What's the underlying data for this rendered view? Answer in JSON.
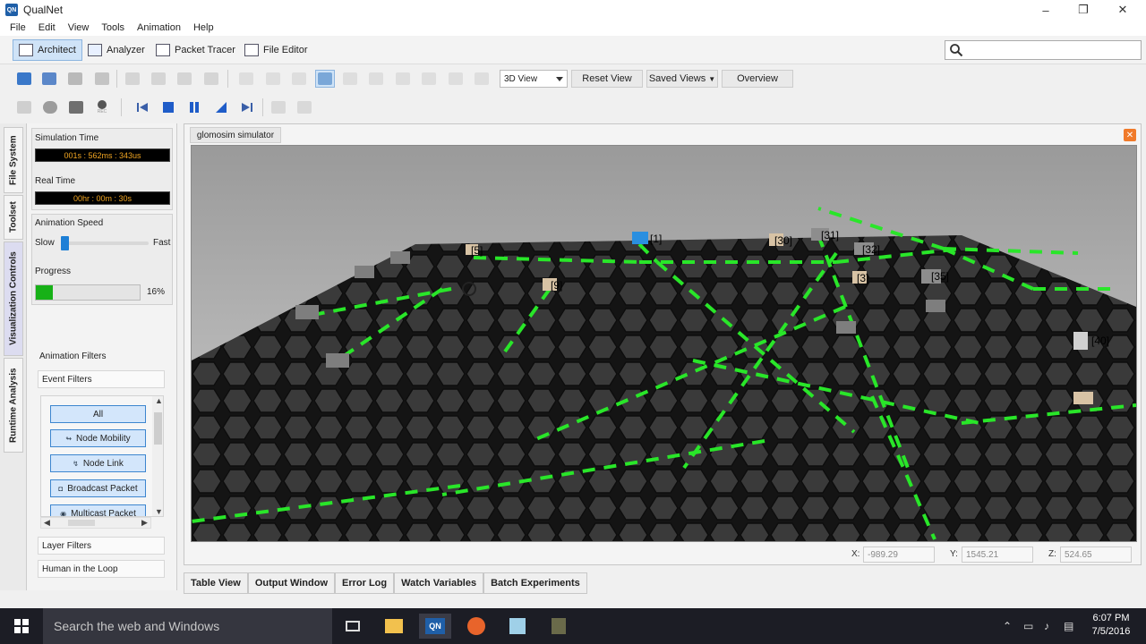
{
  "app": {
    "title": "QualNet",
    "logo_text": "QN"
  },
  "window_controls": {
    "minimize": "–",
    "maximize": "❐",
    "close": "✕"
  },
  "menu": [
    "File",
    "Edit",
    "View",
    "Tools",
    "Animation",
    "Help"
  ],
  "perspectives": [
    {
      "label": "Architect",
      "active": true
    },
    {
      "label": "Analyzer",
      "active": false
    },
    {
      "label": "Packet Tracer",
      "active": false
    },
    {
      "label": "File Editor",
      "active": false
    }
  ],
  "search": {
    "placeholder": ""
  },
  "toolbar": {
    "view_select": "3D View",
    "reset_view": "Reset View",
    "saved_views": "Saved Views",
    "overview": "Overview",
    "rec_label": "REC"
  },
  "side_tabs": [
    "File System",
    "Toolset",
    "Visualization Controls",
    "Runtime Analysis"
  ],
  "controls": {
    "sim_time_label": "Simulation Time",
    "sim_time_value": "001s : 562ms : 343us",
    "real_time_label": "Real Time",
    "real_time_value": "00hr : 00m : 30s",
    "anim_speed_label": "Animation Speed",
    "slow": "Slow",
    "fast": "Fast",
    "anim_speed_level": 0.03,
    "progress_label": "Progress",
    "progress_text": "16%",
    "progress_value": 0.16
  },
  "filters": {
    "title": "Animation Filters",
    "event_filters": "Event Filters",
    "items": [
      "All",
      "Node Mobility",
      "Node Link",
      "Broadcast Packet",
      "Multicast Packet"
    ],
    "layer_filters": "Layer Filters",
    "human_in_loop": "Human in the Loop"
  },
  "editor": {
    "tab": "glomosim simulator",
    "close": "✕",
    "node_labels": [
      "[1]",
      "[5]",
      "[9]",
      "[30]",
      "[31]",
      "[32]",
      "[35]",
      "[40]",
      "[3]"
    ]
  },
  "coords": {
    "x_label": "X:",
    "x_value": "-989.29",
    "y_label": "Y:",
    "y_value": "1545.21",
    "z_label": "Z:",
    "z_value": "524.65"
  },
  "bottom_tabs": [
    "Table View",
    "Output Window",
    "Error Log",
    "Watch Variables",
    "Batch Experiments"
  ],
  "taskbar": {
    "search_text": "Search the web and Windows",
    "time": "6:07 PM",
    "date": "7/5/2016",
    "qualnet_icon_text": "QN"
  },
  "colors": {
    "accent": "#1d7fd6",
    "progress": "#17b117",
    "link": "#29e629",
    "lcd_text": "#f2a622"
  }
}
